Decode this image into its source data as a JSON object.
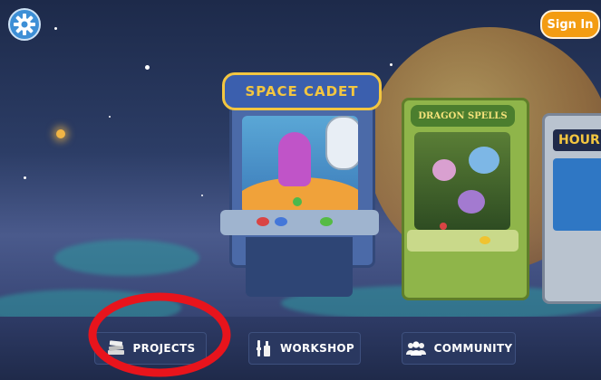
{
  "settings": {
    "icon": "gear-icon"
  },
  "header": {
    "sign_in_label": "Sign In"
  },
  "games": [
    {
      "title": "SPACE CADET"
    },
    {
      "title": "DRAGON SPELLS"
    },
    {
      "title": "HOUR"
    }
  ],
  "nav": [
    {
      "label": "PROJECTS",
      "icon": "projects-icon"
    },
    {
      "label": "WORKSHOP",
      "icon": "workshop-icon"
    },
    {
      "label": "COMMUNITY",
      "icon": "community-icon"
    }
  ],
  "colors": {
    "sign_in": "#f39c12",
    "highlight_circle": "#e8141c",
    "nav_button": "#2a3860"
  }
}
